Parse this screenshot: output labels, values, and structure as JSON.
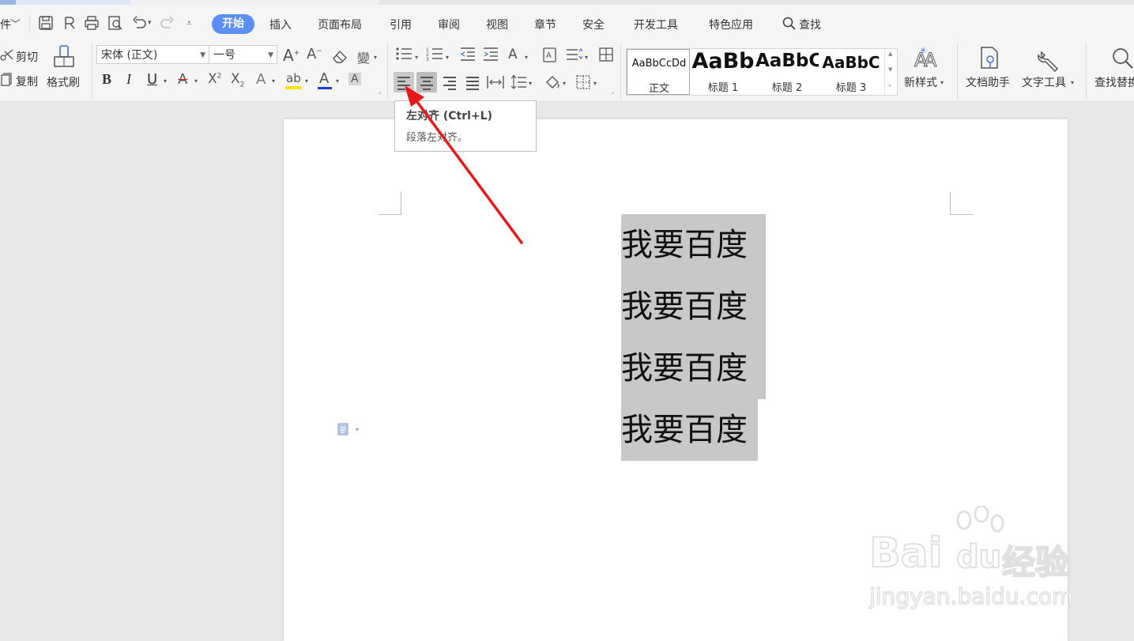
{
  "menu": {
    "file_partial": "件",
    "tabs": [
      "插入",
      "页面布局",
      "引用",
      "审阅",
      "视图",
      "章节",
      "安全",
      "开发工具",
      "特色应用"
    ],
    "active_tab": "开始",
    "search": "查找"
  },
  "clipboard": {
    "cut": "剪切",
    "copy": "复制",
    "format_painter": "格式刷"
  },
  "font": {
    "name": "宋体 (正文)",
    "size": "一号",
    "bold": "B",
    "italic": "I",
    "underline": "U"
  },
  "styles": {
    "items": [
      {
        "preview": "AaBbCcDd",
        "label": "正文"
      },
      {
        "preview": "AaBb",
        "label": "标题 1"
      },
      {
        "preview": "AaBbC",
        "label": "标题 2"
      },
      {
        "preview": "AaBbC",
        "label": "标题 3"
      }
    ],
    "new_style": "新样式"
  },
  "tools": {
    "doc_assistant": "文档助手",
    "text_tools": "文字工具",
    "find_replace": "查找替换"
  },
  "tooltip": {
    "title": "左对齐 (Ctrl+L)",
    "description": "段落左对齐。"
  },
  "document": {
    "lines": [
      "我要百度",
      "我要百度",
      "我要百度",
      "我要百度"
    ]
  },
  "watermark": {
    "brand_latin": "Bai",
    "brand_du": "du",
    "brand_cn": "经验",
    "url": "jingyan.baidu.com"
  },
  "colors": {
    "active_tab": "#5b8ff5",
    "selection": "#c8c8c8",
    "arrow": "#e8191a",
    "highlight_yellow": "#ffe600",
    "font_color_red": "#e02020",
    "font_color_blue": "#1f3fd0"
  }
}
